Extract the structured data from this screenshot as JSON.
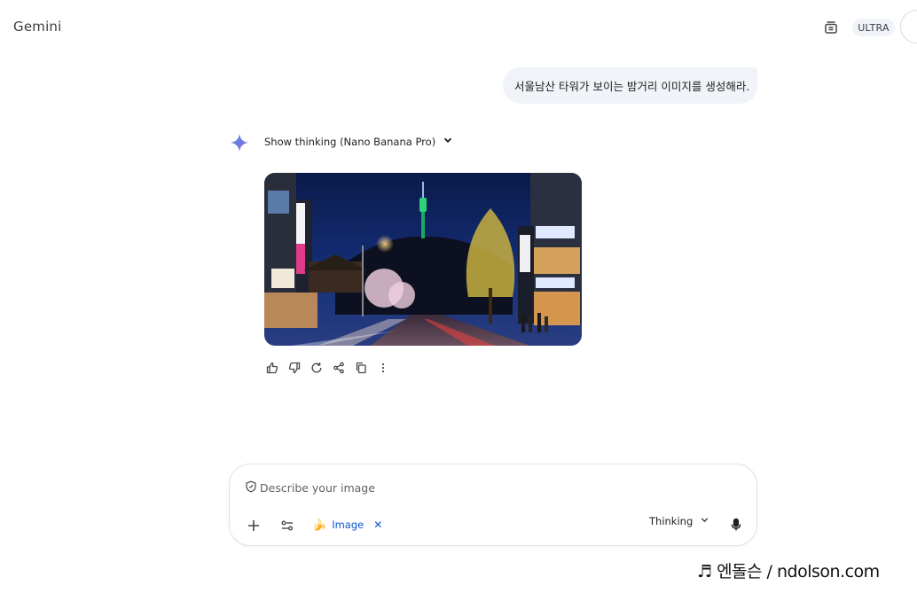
{
  "header": {
    "app_title": "Gemini",
    "plan_badge": "ULTRA",
    "temp_chat_icon": "temporary-chat-icon"
  },
  "conversation": {
    "user_prompt": "서울남산 타워가 보이는 밤거리 이미지를 생성해라.",
    "thinking_label": "Show thinking (Nano Banana Pro)",
    "response_image": "night-street-namsan-tower-image",
    "actions": [
      "thumbs-up-icon",
      "thumbs-down-icon",
      "regenerate-icon",
      "share-icon",
      "copy-icon",
      "more-options-icon"
    ]
  },
  "composer": {
    "placeholder": "Describe your image",
    "tool_chip_label": "Image",
    "tool_chip_emoji": "🍌",
    "mode_label": "Thinking"
  },
  "watermark": {
    "text": "♬ 엔돌슨 / ndolson.com"
  },
  "colors": {
    "accent_blue": "#0b57d0",
    "bubble_bg": "#f0f4f9",
    "spark_blue": "#4a8cf7"
  }
}
